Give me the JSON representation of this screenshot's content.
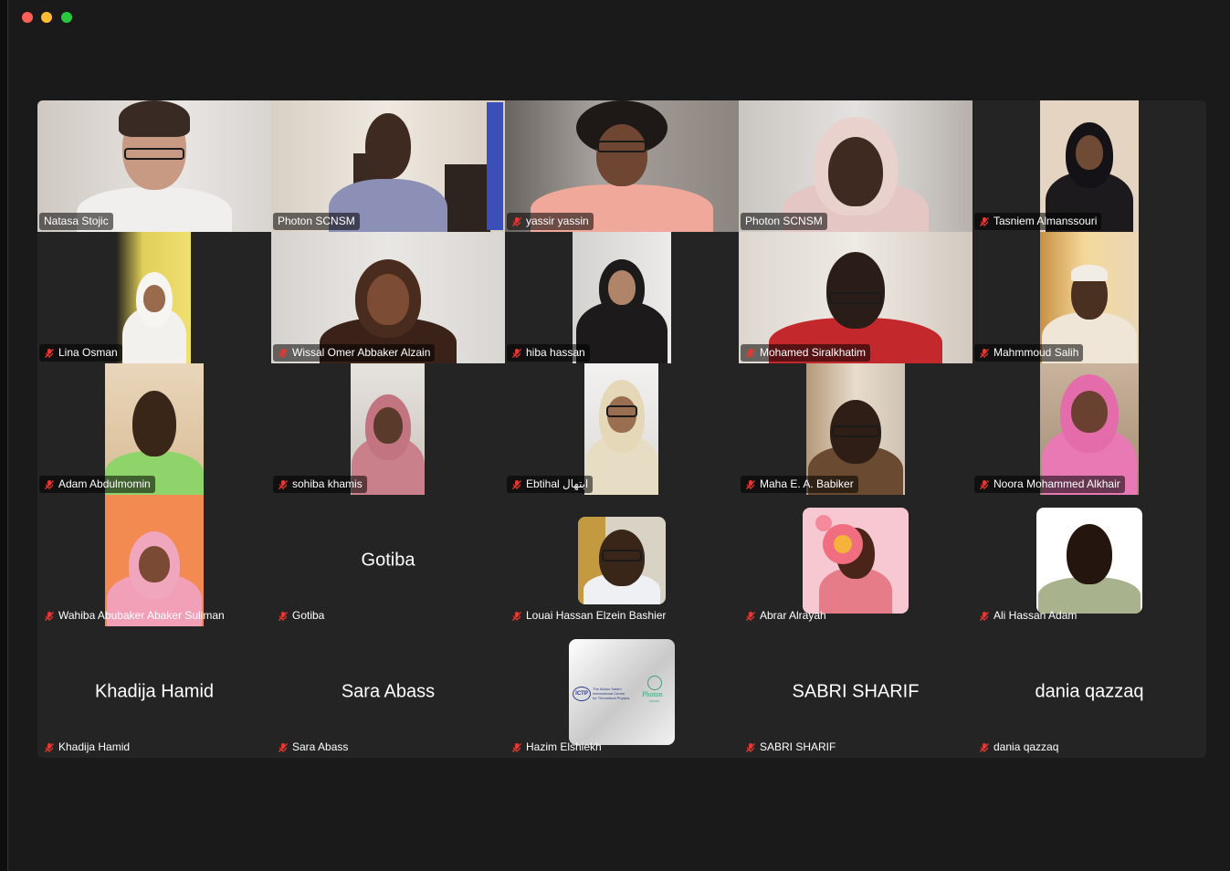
{
  "window": {
    "title": "",
    "traffic_lights": {
      "close_color": "#fe5f57",
      "minimize_color": "#febc2e",
      "zoom_color": "#28c840"
    }
  },
  "gallery": {
    "active_color": "#23d959",
    "mute_color": "#e8372f",
    "participants": [
      {
        "name": "Natasa Stojic",
        "muted": false,
        "video": true
      },
      {
        "name": "Photon SCNSM",
        "muted": false,
        "video": true,
        "active": true
      },
      {
        "name": "yassir yassin",
        "muted": true,
        "video": true
      },
      {
        "name": "Photon SCNSM",
        "muted": false,
        "video": true
      },
      {
        "name": "Tasniem Almanssouri",
        "muted": true,
        "video": true
      },
      {
        "name": "Lina Osman",
        "muted": true,
        "video": true
      },
      {
        "name": "Wissal Omer Abbaker Alzain",
        "muted": true,
        "video": true
      },
      {
        "name": "hiba hassan",
        "muted": true,
        "video": true
      },
      {
        "name": "Mohamed Siralkhatim",
        "muted": true,
        "video": true
      },
      {
        "name": "Mahmmoud Salih",
        "muted": true,
        "video": true
      },
      {
        "name": "Adam Abdulmomin",
        "muted": true,
        "video": true
      },
      {
        "name": "sohiba khamis",
        "muted": true,
        "video": true
      },
      {
        "name": "Ebtihal ابتهال",
        "muted": true,
        "video": true
      },
      {
        "name": "Maha E. A. Babiker",
        "muted": true,
        "video": true
      },
      {
        "name": "Noora Mohammed Alkhair",
        "muted": true,
        "video": true
      },
      {
        "name": "Wahiba Abubaker Abaker Suliman",
        "muted": true,
        "video": true
      },
      {
        "name": "Gotiba",
        "muted": true,
        "video": false,
        "display_name": "Gotiba"
      },
      {
        "name": "Louai Hassan Elzein Bashier",
        "muted": true,
        "video": false,
        "avatar": "profile-photo"
      },
      {
        "name": "Abrar Alrayah",
        "muted": true,
        "video": false,
        "avatar": "flower-illustration"
      },
      {
        "name": "Ali Hassan Adam",
        "muted": true,
        "video": false,
        "avatar": "profile-photo"
      },
      {
        "name": "Khadija Hamid",
        "muted": true,
        "video": false,
        "display_name": "Khadija Hamid"
      },
      {
        "name": "Sara Abass",
        "muted": true,
        "video": false,
        "display_name": "Sara Abass"
      },
      {
        "name": "Hazim Elshiekh",
        "muted": true,
        "video": false,
        "avatar": "ictp-photon-logo"
      },
      {
        "name": "SABRI SHARIF",
        "muted": true,
        "video": false,
        "display_name": "SABRI SHARIF"
      },
      {
        "name": "dania qazzaq",
        "muted": true,
        "video": false,
        "display_name": "dania qazzaq"
      }
    ]
  },
  "logo": {
    "left_mark": "ICTP",
    "org_line1": "The Abdus Salam",
    "org_line2": "International Centre",
    "org_line3": "for Theoretical Physics",
    "right_mark": "Photon",
    "right_sub": "SCNSM"
  }
}
